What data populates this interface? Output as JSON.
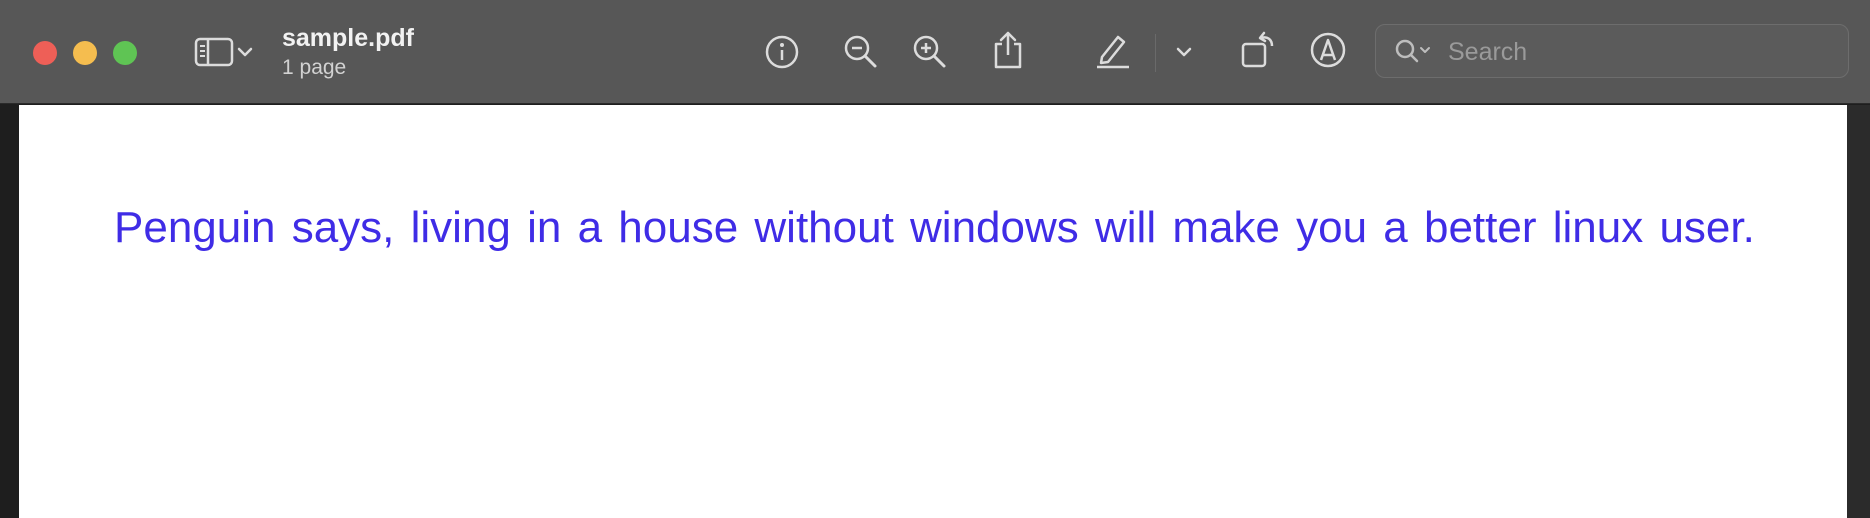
{
  "window": {
    "title": "sample.pdf",
    "subtitle": "1 page"
  },
  "toolbar": {
    "search_placeholder": "Search"
  },
  "document": {
    "text": "Penguin says, living in a house without windows will make you a better linux user.",
    "text_color": "#3f2ce6"
  },
  "icons": [
    "sidebar-icon",
    "chevron-down-icon",
    "info-icon",
    "zoom-out-icon",
    "zoom-in-icon",
    "share-icon",
    "highlight-pen-icon",
    "chevron-down-icon",
    "rotate-icon",
    "markup-icon",
    "search-icon"
  ]
}
